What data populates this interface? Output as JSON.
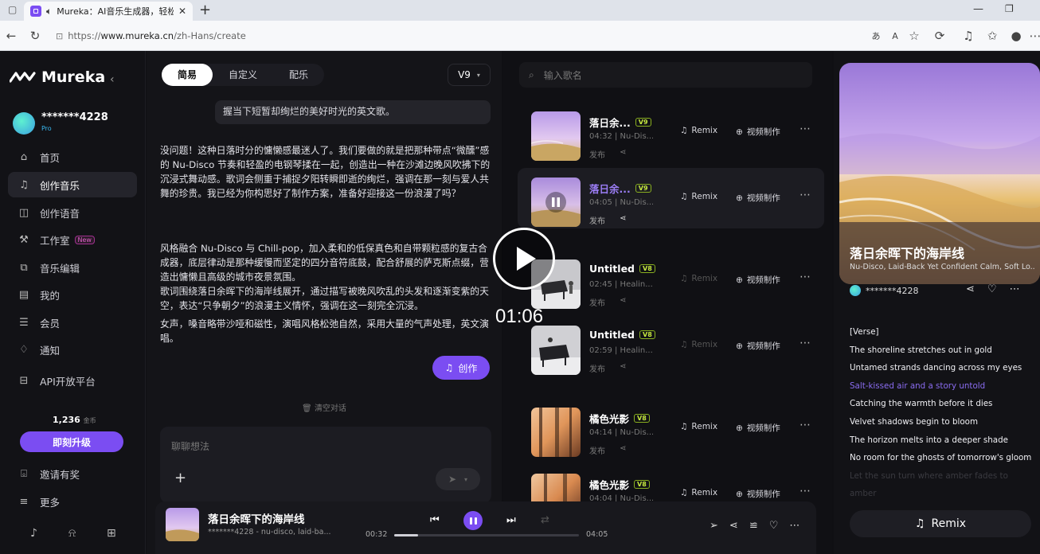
{
  "browser": {
    "tab_title": "Mureka：AI音乐生成器，轻松",
    "url_prefix": "https://",
    "url_host": "www.mureka.cn",
    "url_path": "/zh-Hans/create",
    "tab_close": "✕",
    "new_tab": "+"
  },
  "sidebar": {
    "logo": "Mureka",
    "username": "*******4228",
    "plan": "Pro",
    "items": [
      {
        "label": "首页",
        "icon": "home-icon"
      },
      {
        "label": "创作音乐",
        "icon": "music-note-icon"
      },
      {
        "label": "创作语音",
        "icon": "voice-icon"
      },
      {
        "label": "工作室",
        "icon": "studio-icon",
        "badge": "New"
      },
      {
        "label": "音乐编辑",
        "icon": "edit-icon"
      },
      {
        "label": "我的",
        "icon": "library-icon"
      },
      {
        "label": "会员",
        "icon": "member-icon"
      },
      {
        "label": "通知",
        "icon": "bell-icon"
      },
      {
        "label": "API开放平台",
        "icon": "api-icon"
      }
    ],
    "coins": "1,236",
    "coins_unit": "金币",
    "upgrade": "即刻升级",
    "invite": "邀请有奖",
    "more": "更多"
  },
  "chat": {
    "tabs": [
      "简易",
      "自定义",
      "配乐"
    ],
    "version": "V9",
    "user_bubble": "握当下短暂却绚烂的美好时光的英文歌。",
    "reply1": "没问题！这种日落时分的慵懒感最迷人了。我们要做的就是把那种带点“微醺”感的 Nu-Disco 节奏和轻盈的电钢琴揉在一起，创造出一种在沙滩边晚风吹拂下的沉浸式舞动感。歌词会侧重于捕捉夕阳转瞬即逝的绚烂，强调在那一刻与爱人共舞的珍贵。我已经为你构思好了制作方案，准备好迎接这一份浪漫了吗？",
    "reply2a": "风格融合 Nu-Disco 与 Chill-pop，加入柔和的低保真色和自带颗粒感的复古合成器，底层律动是那种缓慢而坚定的四分音符底鼓，配合舒展的萨克斯点缀，营造出慵懒且高级的城市夜景氛围。",
    "reply2b": "歌词围绕落日余晖下的海岸线展开，通过描写被晚风吹乱的头发和逐渐变紫的天空，表达“只争朝夕”的浪漫主义情怀，强调在这一刻完全沉浸。",
    "reply2c": "女声，嗓音略带沙哑和磁性，演唱风格松弛自然，采用大量的气声处理，英文演唱。",
    "create_button": "创作",
    "clear": "清空对话",
    "input_placeholder": "聊聊想法"
  },
  "songs": {
    "search_placeholder": "输入歌名",
    "publish": "发布",
    "remix": "Remix",
    "video": "视频制作",
    "items": [
      {
        "title": "落日余...",
        "version": "V9",
        "meta": "04:32 | Nu-Dis..."
      },
      {
        "title": "落日余...",
        "version": "V9",
        "meta": "04:05 | Nu-Dis..."
      },
      {
        "title": "Untitled",
        "version": "V8",
        "meta": "02:45 | Healin..."
      },
      {
        "title": "Untitled",
        "version": "V8",
        "meta": "02:59 | Healin..."
      },
      {
        "title": "橘色光影",
        "version": "V8",
        "meta": "04:14 | Nu-Dis..."
      },
      {
        "title": "橘色光影",
        "version": "V8",
        "meta": "04:04 | Nu-Dis..."
      }
    ]
  },
  "detail": {
    "title": "落日余晖下的海岸线",
    "subtitle": "Nu-Disco, Laid-Back Yet Confident Calm, Soft Lo...",
    "user": "*******4228",
    "lyrics": [
      "[Verse]",
      "The shoreline stretches out in gold",
      "Untamed strands dancing across my eyes",
      "Salt-kissed air and a story untold",
      "Catching the warmth before it dies",
      "Velvet shadows begin to bloom",
      "The horizon melts into a deeper shade",
      "No room for the ghosts of tomorrow's gloom",
      "Let the sun turn where amber fades to amber"
    ],
    "current_line": 3,
    "remix": "Remix"
  },
  "player": {
    "title": "落日余晖下的海岸线",
    "sub": "*******4228 - nu-disco, laid-ba...",
    "elapsed": "00:32",
    "total": "04:05",
    "progress": 0.13
  },
  "video": {
    "timestamp": "01:06"
  },
  "colors": {
    "accent": "#7b4df2",
    "version_tag": "#c6e840",
    "bg": "#0f0f13"
  }
}
